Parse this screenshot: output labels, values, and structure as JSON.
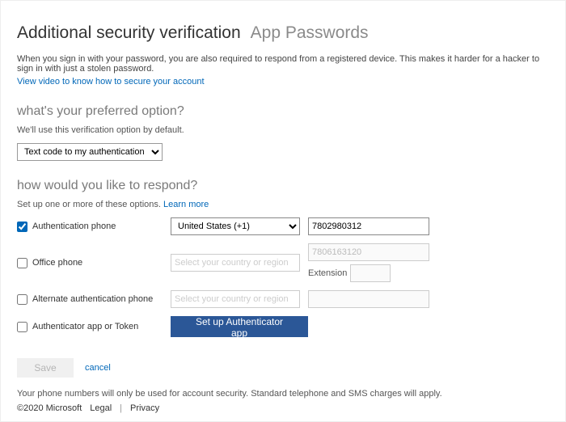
{
  "header": {
    "title_active": "Additional security verification",
    "title_inactive": "App Passwords"
  },
  "intro": {
    "text": "When you sign in with your password, you are also required to respond from a registered device. This makes it harder for a hacker to sign in with just a stolen password.",
    "video_link": "View video to know how to secure your account"
  },
  "preferred": {
    "heading": "what's your preferred option?",
    "sub": "We'll use this verification option by default.",
    "select_value": "Text code to my authentication p"
  },
  "respond": {
    "heading": "how would you like to respond?",
    "sub_pre": "Set up one or more of these options. ",
    "sub_link": "Learn more",
    "rows": {
      "auth_phone": {
        "label": "Authentication phone",
        "checked": true,
        "country": "United States (+1)",
        "phone": "7802980312"
      },
      "office_phone": {
        "label": "Office phone",
        "checked": false,
        "country_placeholder": "Select your country or region",
        "phone": "7806163120",
        "extension_label": "Extension"
      },
      "alt_phone": {
        "label": "Alternate authentication phone",
        "checked": false,
        "country_placeholder": "Select your country or region",
        "phone": ""
      },
      "auth_app": {
        "label": "Authenticator app or Token",
        "checked": false,
        "button": "Set up Authenticator app"
      }
    }
  },
  "actions": {
    "save": "Save",
    "cancel": "cancel"
  },
  "disclaimer": "Your phone numbers will only be used for account security. Standard telephone and SMS charges will apply.",
  "footer": {
    "copyright": "©2020 Microsoft",
    "legal": "Legal",
    "privacy": "Privacy"
  }
}
